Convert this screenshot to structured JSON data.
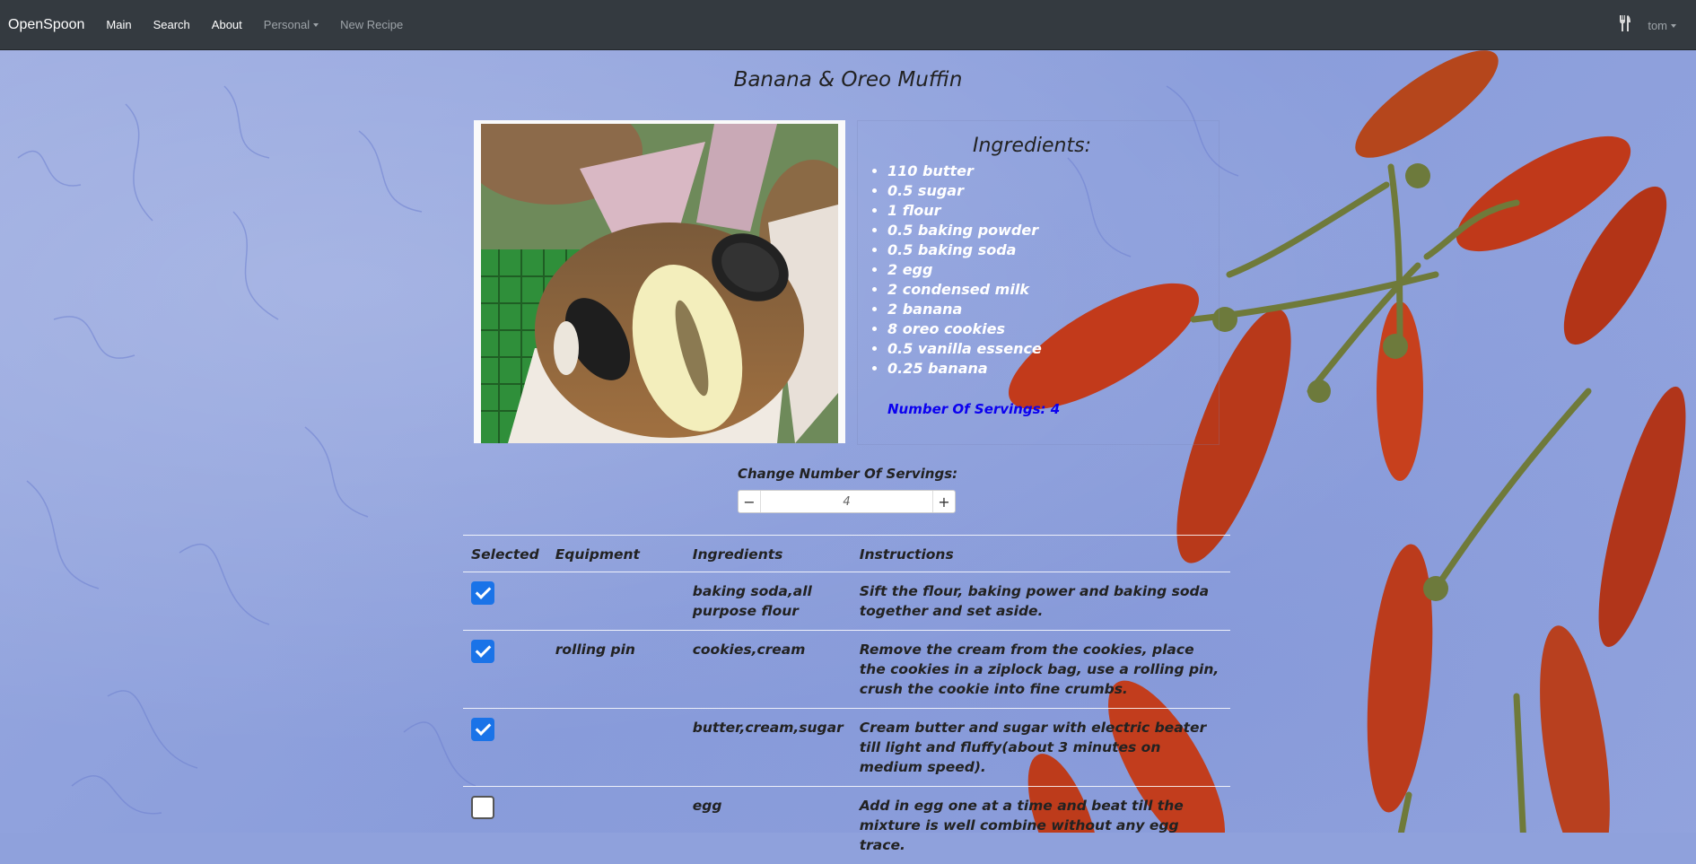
{
  "navbar": {
    "brand": "OpenSpoon",
    "links": [
      "Main",
      "Search",
      "About"
    ],
    "personal": "Personal",
    "new_recipe": "New Recipe",
    "utensils_icon": "fork-knife-icon",
    "user": "tom"
  },
  "recipe": {
    "title": "Banana & Oreo Muffin",
    "ingredients_title": "Ingredients:",
    "ingredients": [
      "110 butter",
      "0.5 sugar",
      "1 flour",
      "0.5 baking powder",
      "0.5 baking soda",
      "2 egg",
      "2 condensed milk",
      "2 banana",
      "8 oreo cookies",
      "0.5 vanilla essence",
      "0.25 banana"
    ],
    "servings_text": "Number Of Servings: 4",
    "change_servings_label": "Change Number Of Servings:",
    "servings_value": "4",
    "minus": "−",
    "plus": "+"
  },
  "table": {
    "headers": [
      "Selected",
      "Equipment",
      "Ingredients",
      "Instructions"
    ],
    "rows": [
      {
        "selected": true,
        "equipment": "",
        "ingredients": "baking soda,all purpose flour",
        "instructions": "Sift the flour, baking power and baking soda together and set aside."
      },
      {
        "selected": true,
        "equipment": "rolling pin",
        "ingredients": "cookies,cream",
        "instructions": "Remove the cream from the cookies, place the cookies in a ziplock bag, use a rolling pin, crush the cookie into fine crumbs."
      },
      {
        "selected": true,
        "equipment": "",
        "ingredients": "butter,cream,sugar",
        "instructions": "Cream butter and sugar with electric beater till light and fluffy(about 3 minutes on medium speed)."
      },
      {
        "selected": false,
        "equipment": "",
        "ingredients": "egg",
        "instructions": "Add in egg one at a time and beat till the mixture is well combine without any egg trace."
      }
    ]
  },
  "colors": {
    "navbar": "#343a40",
    "checkbox": "#1a73e8",
    "servings": "#0b00f0",
    "ingredient_text": "#ffffff"
  }
}
